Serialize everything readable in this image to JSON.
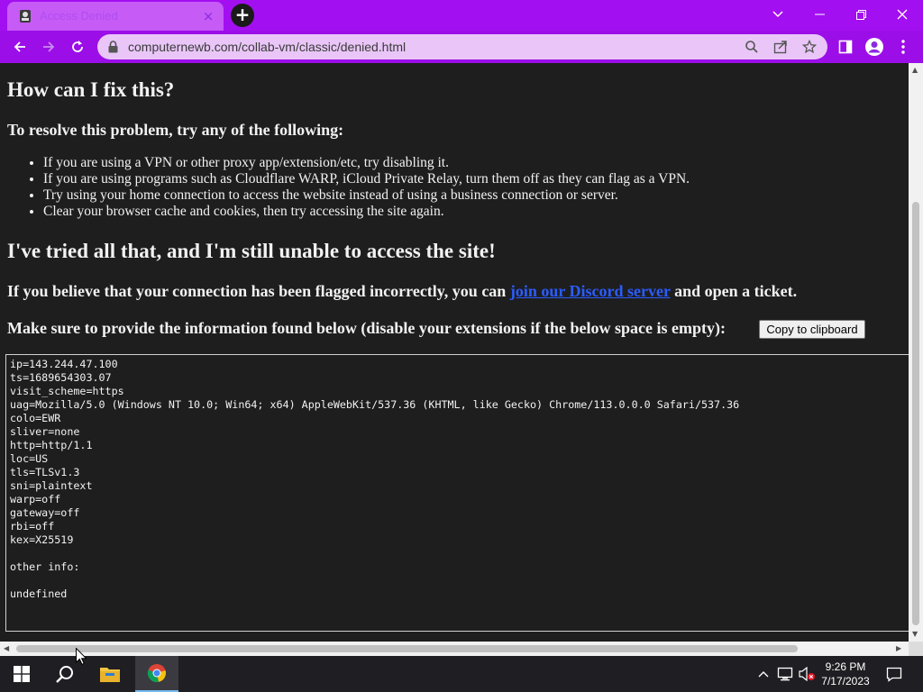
{
  "browser": {
    "tab_title": "Access Denied",
    "tab_close": "×",
    "new_tab": "+",
    "url": "computernewb.com/collab-vm/classic/denied.html",
    "accent": "#a20ff0"
  },
  "page": {
    "heading_fix": "How can I fix this?",
    "resolve_intro": "To resolve this problem, try any of the following:",
    "tips": [
      "If you are using a VPN or other proxy app/extension/etc, try disabling it.",
      "If you are using programs such as Cloudflare WARP, iCloud Private Relay, turn them off as they can flag as a VPN.",
      "Try using your home connection to access the website instead of using a business connection or server.",
      "Clear your browser cache and cookies, then try accessing the site again."
    ],
    "heading_tried": "I've tried all that, and I'm still unable to access the site!",
    "flagged_before": "If you believe that your connection has been flagged incorrectly, you can ",
    "discord_link": "join our Discord server",
    "flagged_after": " and open a ticket.",
    "provide_info": "Make sure to provide the information found below (disable your extensions if the below space is empty):",
    "copy_button": "Copy to clipboard",
    "trace_info": "ip=143.244.47.100\nts=1689654303.07\nvisit_scheme=https\nuag=Mozilla/5.0 (Windows NT 10.0; Win64; x64) AppleWebKit/537.36 (KHTML, like Gecko) Chrome/113.0.0.0 Safari/537.36\ncolo=EWR\nsliver=none\nhttp=http/1.1\nloc=US\ntls=TLSv1.3\nsni=plaintext\nwarp=off\ngateway=off\nrbi=off\nkex=X25519\n\nother info:\n\nundefined"
  },
  "taskbar": {
    "time": "9:26 PM",
    "date": "7/17/2023",
    "pinned": [
      "start-icon",
      "search-icon",
      "file-explorer-icon",
      "chrome-icon"
    ]
  }
}
